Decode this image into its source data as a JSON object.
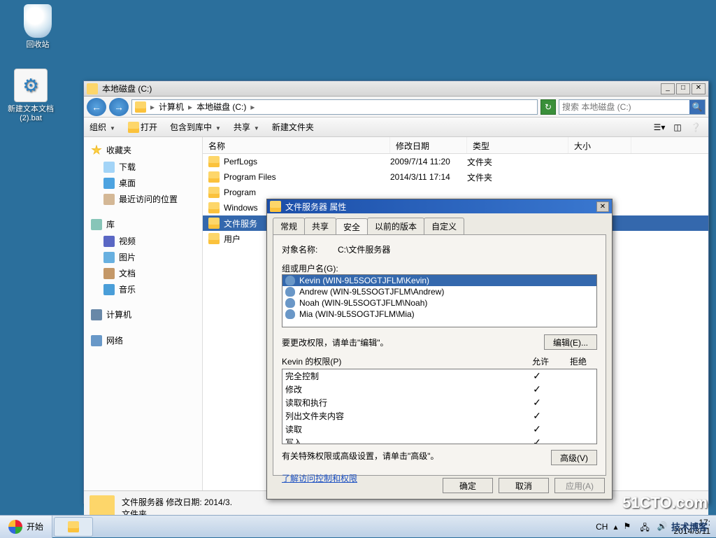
{
  "desktop": {
    "recycle_bin": "回收站",
    "bat_file": "新建文本文档 (2).bat"
  },
  "explorer": {
    "title": "本地磁盘 (C:)",
    "breadcrumb": {
      "seg1": "计算机",
      "seg2": "本地磁盘 (C:)"
    },
    "search_placeholder": "搜索 本地磁盘 (C:)",
    "toolbar": {
      "organize": "组织",
      "open": "打开",
      "include": "包含到库中",
      "share": "共享",
      "newfolder": "新建文件夹"
    },
    "sidebar": {
      "favorites": "收藏夹",
      "downloads": "下载",
      "desktop": "桌面",
      "recent": "最近访问的位置",
      "libraries": "库",
      "videos": "视频",
      "pictures": "图片",
      "documents": "文档",
      "music": "音乐",
      "computer": "计算机",
      "network": "网络"
    },
    "cols": {
      "name": "名称",
      "date": "修改日期",
      "type": "类型",
      "size": "大小"
    },
    "rows": [
      {
        "name": "PerfLogs",
        "date": "2009/7/14 11:20",
        "type": "文件夹"
      },
      {
        "name": "Program Files",
        "date": "2014/3/11 17:14",
        "type": "文件夹"
      },
      {
        "name": "Program",
        "date": "",
        "type": ""
      },
      {
        "name": "Windows",
        "date": "",
        "type": ""
      },
      {
        "name": "文件服务",
        "date": "",
        "type": "",
        "sel": true
      },
      {
        "name": "用户",
        "date": "",
        "type": ""
      }
    ],
    "status": {
      "line1": "文件服务器 修改日期: 2014/3.",
      "line2": "文件夹"
    }
  },
  "dialog": {
    "title": "文件服务器 属性",
    "tabs": {
      "general": "常规",
      "share": "共享",
      "security": "安全",
      "prev": "以前的版本",
      "custom": "自定义"
    },
    "obj_label": "对象名称:",
    "obj_value": "C:\\文件服务器",
    "group_label": "组或用户名(G):",
    "users": [
      {
        "n": "Kevin (WIN-9L5SOGTJFLM\\Kevin)",
        "sel": true
      },
      {
        "n": "Andrew (WIN-9L5SOGTJFLM\\Andrew)"
      },
      {
        "n": "Noah (WIN-9L5SOGTJFLM\\Noah)"
      },
      {
        "n": "Mia (WIN-9L5SOGTJFLM\\Mia)"
      }
    ],
    "edit_hint": "要更改权限，请单击\"编辑\"。",
    "edit_btn": "编辑(E)...",
    "perm_label": "Kevin 的权限(P)",
    "allow": "允许",
    "deny": "拒绝",
    "perms": [
      {
        "n": "完全控制",
        "a": true
      },
      {
        "n": "修改",
        "a": true
      },
      {
        "n": "读取和执行",
        "a": true
      },
      {
        "n": "列出文件夹内容",
        "a": true
      },
      {
        "n": "读取",
        "a": true
      },
      {
        "n": "写入",
        "a": true
      }
    ],
    "adv_hint": "有关特殊权限或高级设置，请单击\"高级\"。",
    "adv_btn": "高级(V)",
    "link": "了解访问控制和权限",
    "ok": "确定",
    "cancel": "取消",
    "apply": "应用(A)"
  },
  "taskbar": {
    "start": "开始",
    "lang": "CH",
    "time": "17:",
    "date": "2014/3/11"
  },
  "watermark": "51CTO.com",
  "watermark2": "技术博客"
}
